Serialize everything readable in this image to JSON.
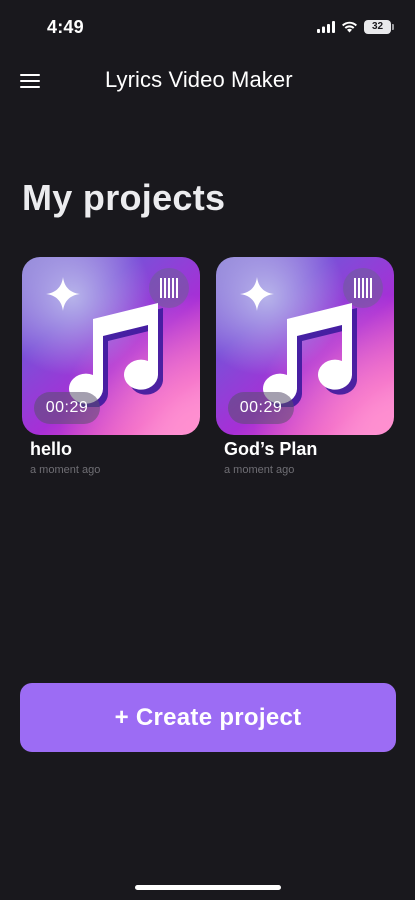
{
  "status_bar": {
    "time": "4:49",
    "battery": "32",
    "icons": [
      "signal-icon",
      "wifi-icon",
      "battery-icon"
    ]
  },
  "app_bar": {
    "title": "Lyrics Video Maker",
    "menu_icon": "hamburger-menu-icon"
  },
  "section_title": "My projects",
  "projects": [
    {
      "name": "hello",
      "duration": "00:29",
      "updated": "a moment ago",
      "icons": [
        "sparkle-icon",
        "barcode-icon",
        "music-note-icon"
      ]
    },
    {
      "name": "God’s Plan",
      "duration": "00:29",
      "updated": "a moment ago",
      "icons": [
        "sparkle-icon",
        "barcode-icon",
        "music-note-icon"
      ]
    }
  ],
  "create_button": {
    "label": "+ Create project"
  },
  "colors": {
    "background": "#19181d",
    "accent": "#9c6cf4",
    "muted_text": "#6f6e74"
  }
}
